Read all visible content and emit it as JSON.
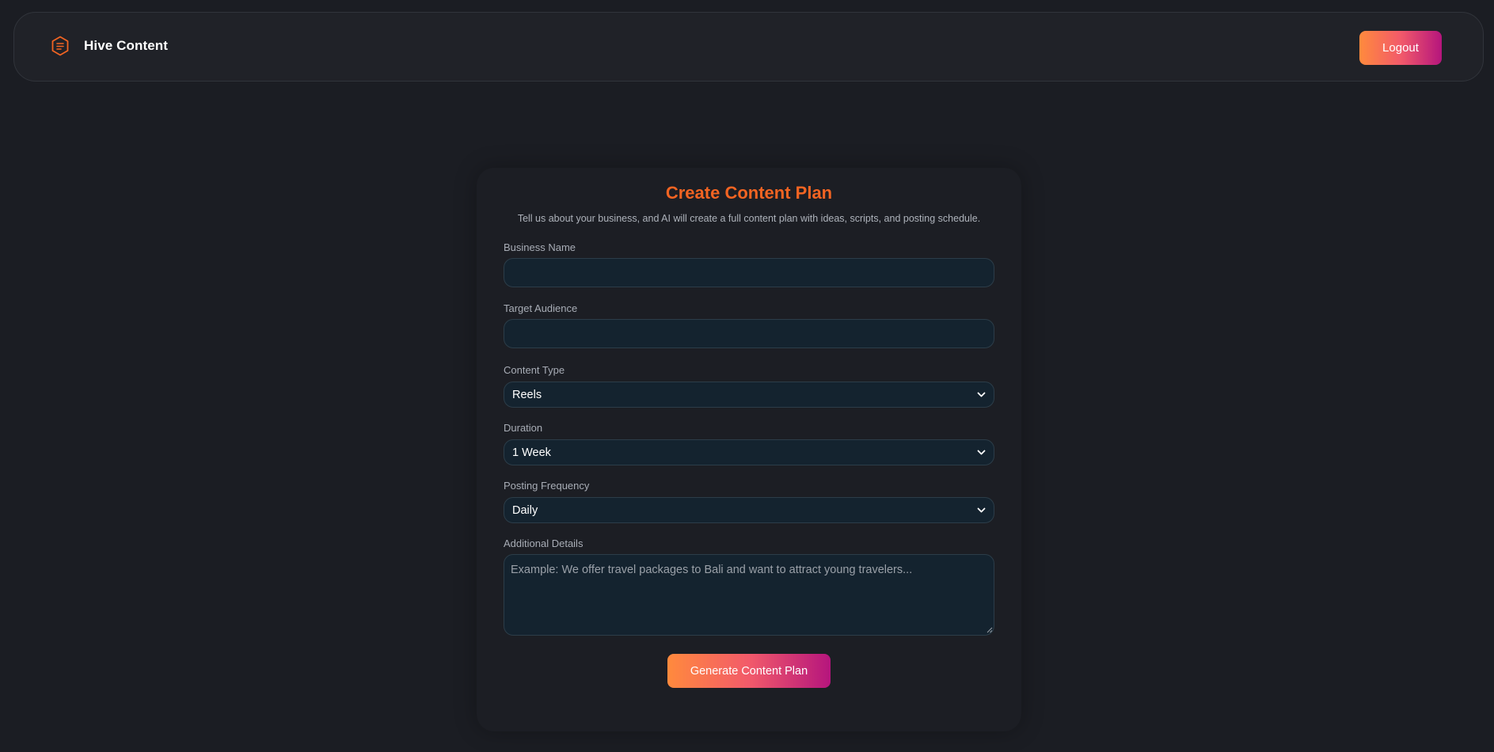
{
  "header": {
    "brand_name": "Hive Content",
    "logout_label": "Logout",
    "accent_color": "#f26422"
  },
  "form": {
    "title": "Create Content Plan",
    "subtitle": "Tell us about your business, and AI will create a full content plan with ideas, scripts, and posting schedule.",
    "business_name": {
      "label": "Business Name",
      "value": ""
    },
    "target_audience": {
      "label": "Target Audience",
      "value": ""
    },
    "content_type": {
      "label": "Content Type",
      "selected": "Reels"
    },
    "duration": {
      "label": "Duration",
      "selected": "1 Week"
    },
    "posting_frequency": {
      "label": "Posting Frequency",
      "selected": "Daily"
    },
    "additional_details": {
      "label": "Additional Details",
      "placeholder": "Example: We offer travel packages to Bali and want to attract young travelers..."
    },
    "submit_label": "Generate Content Plan"
  },
  "icons": {
    "brand": "hexagon-document-icon",
    "select_arrow": "chevron-down-icon"
  }
}
